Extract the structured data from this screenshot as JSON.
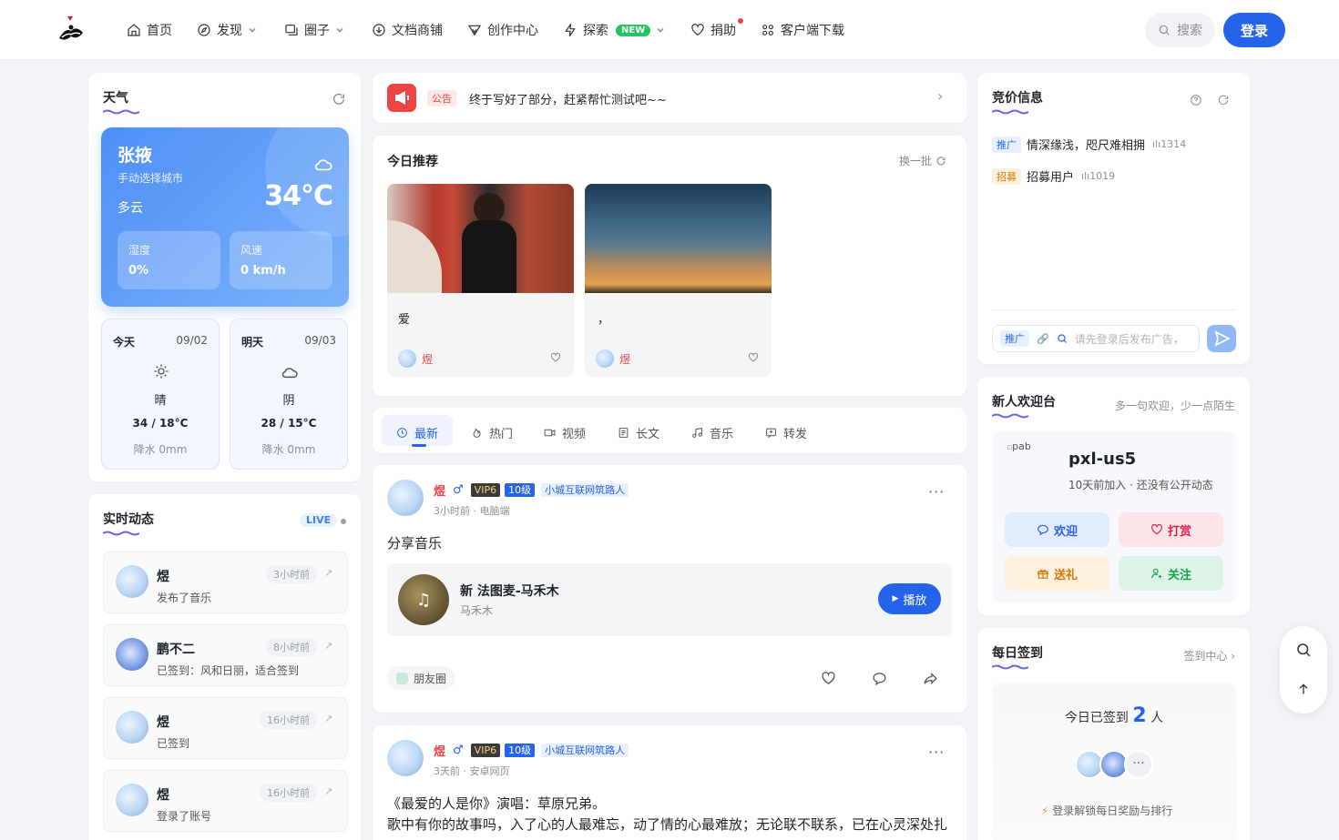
{
  "header": {
    "nav": [
      {
        "label": "首页",
        "icon": "home-icon"
      },
      {
        "label": "发现",
        "icon": "compass-icon",
        "dropdown": true
      },
      {
        "label": "圈子",
        "icon": "circle-group-icon",
        "dropdown": true
      },
      {
        "label": "文档商铺",
        "icon": "download-icon"
      },
      {
        "label": "创作中心",
        "icon": "vector-icon"
      },
      {
        "label": "探索",
        "icon": "lightning-icon",
        "badge": "NEW",
        "dropdown": true
      },
      {
        "label": "捐助",
        "icon": "heart-icon",
        "dot": true
      },
      {
        "label": "客户端下载",
        "icon": "apps-icon"
      }
    ],
    "search_label": "搜索",
    "login_label": "登录"
  },
  "weather": {
    "title": "天气",
    "city": "张掖",
    "city_note": "手动选择城市",
    "condition": "多云",
    "temp": "34°C",
    "humidity_label": "湿度",
    "humidity": "0%",
    "wind_label": "风速",
    "wind": "0 km/h",
    "days": [
      {
        "name": "今天",
        "date": "09/02",
        "cond": "晴",
        "temp": "34 / 18°C",
        "rain": "降水 0mm",
        "icon": "sun-icon"
      },
      {
        "name": "明天",
        "date": "09/03",
        "cond": "阴",
        "temp": "28 / 15°C",
        "rain": "降水 0mm",
        "icon": "cloud-icon"
      }
    ]
  },
  "live": {
    "title": "实时动态",
    "badge": "LIVE",
    "items": [
      {
        "user": "煜",
        "time": "3小时前",
        "text": "发布了音乐"
      },
      {
        "user": "鹏不二",
        "time": "8小时前",
        "text": "已签到：风和日丽，适合签到"
      },
      {
        "user": "煜",
        "time": "16小时前",
        "text": "已签到"
      },
      {
        "user": "煜",
        "time": "16小时前",
        "text": "登录了账号"
      }
    ]
  },
  "announcement": {
    "tag": "公告",
    "text": "终于写好了部分，赶紧帮忙测试吧~~"
  },
  "recommend": {
    "title": "今日推荐",
    "refresh": "换一批",
    "items": [
      {
        "title": "爱",
        "user": "煜"
      },
      {
        "title": "，",
        "user": "煜"
      }
    ]
  },
  "tabs": [
    {
      "label": "最新",
      "icon": "clock-icon"
    },
    {
      "label": "热门",
      "icon": "fire-icon"
    },
    {
      "label": "视频",
      "icon": "video-icon"
    },
    {
      "label": "长文",
      "icon": "article-icon"
    },
    {
      "label": "音乐",
      "icon": "music-icon"
    },
    {
      "label": "转发",
      "icon": "repost-icon"
    }
  ],
  "posts": [
    {
      "user": "煜",
      "gender": "♂",
      "vip": "VIP6",
      "level": "10级",
      "title": "小城互联网筑路人",
      "time": "3小时前",
      "device": "电脑端",
      "content": "分享音乐",
      "music": {
        "name": "新 法图麦-马禾木",
        "artist": "马禾木",
        "play": "播放"
      },
      "circle": "朋友圈"
    },
    {
      "user": "煜",
      "gender": "♂",
      "vip": "VIP6",
      "level": "10级",
      "title": "小城互联网筑路人",
      "time": "3天前",
      "device": "安卓网页",
      "line1": "《最爱的人是你》演唱：草原兄弟。",
      "line2": "歌中有你的故事吗，入了心的人最难忘，动了情的心最难放；无论联不联系，已在心灵深处扎"
    }
  ],
  "ads": {
    "title": "竞价信息",
    "items": [
      {
        "tag": "推广",
        "text": "情深缘浅，咫尺难相拥",
        "count": "1314"
      },
      {
        "tag": "招募",
        "text": "招募用户",
        "count": "1019"
      }
    ],
    "input_tag": "推广",
    "placeholder": "请先登录后发布广告，"
  },
  "welcome": {
    "title": "新人欢迎台",
    "subtitle": "多一句欢迎，少一点陌生",
    "avatar_alt": "pab",
    "user": "pxl-us5",
    "info": "10天前加入 · 还没有公开动态",
    "actions": [
      {
        "label": "欢迎",
        "color": "#2563eb",
        "bg": "#e3ecfd",
        "icon": "chat-icon"
      },
      {
        "label": "打赏",
        "color": "#e11d48",
        "bg": "#fde4e8",
        "icon": "heart-icon"
      },
      {
        "label": "送礼",
        "color": "#d97706",
        "bg": "#fdf0de",
        "icon": "gift-icon"
      },
      {
        "label": "关注",
        "color": "#16a34a",
        "bg": "#dcf3e6",
        "icon": "user-add-icon"
      }
    ]
  },
  "signin": {
    "title": "每日签到",
    "link": "签到中心",
    "prefix": "今日已签到",
    "count": "2",
    "suffix": "人",
    "more": "···",
    "tip": "登录解锁每日奖励与排行"
  }
}
